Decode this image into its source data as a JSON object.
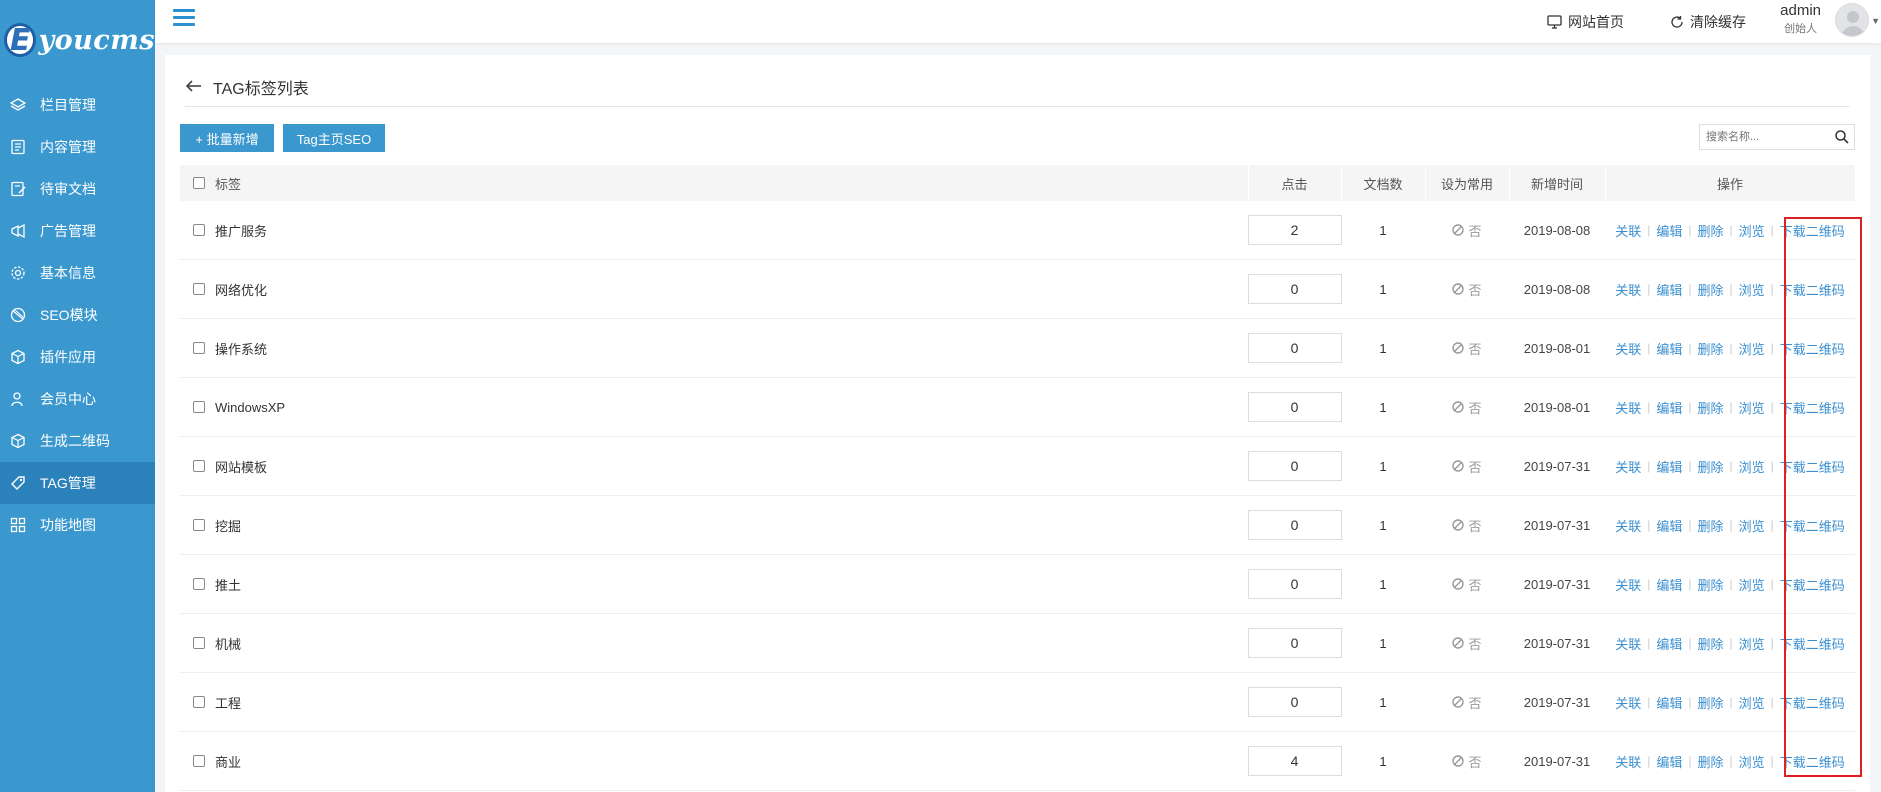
{
  "brand": {
    "logo_letter": "E",
    "logo_text": "youcms"
  },
  "sidebar": {
    "items": [
      {
        "label": "栏目管理",
        "icon": "layers-icon"
      },
      {
        "label": "内容管理",
        "icon": "document-icon"
      },
      {
        "label": "待审文档",
        "icon": "edit-document-icon"
      },
      {
        "label": "广告管理",
        "icon": "megaphone-icon"
      },
      {
        "label": "基本信息",
        "icon": "gear-icon"
      },
      {
        "label": "SEO模块",
        "icon": "globe-icon"
      },
      {
        "label": "插件应用",
        "icon": "cube-icon"
      },
      {
        "label": "会员中心",
        "icon": "user-icon"
      },
      {
        "label": "生成二维码",
        "icon": "cube-icon"
      },
      {
        "label": "TAG管理",
        "icon": "tag-icon",
        "active": true
      },
      {
        "label": "功能地图",
        "icon": "grid-icon"
      }
    ]
  },
  "topbar": {
    "home_label": "网站首页",
    "clear_cache_label": "清除缓存",
    "user_name": "admin",
    "user_role": "创始人"
  },
  "page": {
    "title": "TAG标签列表"
  },
  "toolbar": {
    "batch_add_label": "+ 批量新增",
    "tag_seo_label": "Tag主页SEO",
    "search_placeholder": "搜索名称..."
  },
  "table": {
    "headers": {
      "tag": "标签",
      "clicks": "点击",
      "docs": "文档数",
      "common": "设为常用",
      "added": "新增时间",
      "actions": "操作"
    },
    "actions": [
      "关联",
      "编辑",
      "删除",
      "浏览",
      "下载二维码"
    ],
    "not_common_label": "否",
    "rows": [
      {
        "tag": "推广服务",
        "clicks": "2",
        "docs": "1",
        "date": "2019-08-08"
      },
      {
        "tag": "网络优化",
        "clicks": "0",
        "docs": "1",
        "date": "2019-08-08"
      },
      {
        "tag": "操作系统",
        "clicks": "0",
        "docs": "1",
        "date": "2019-08-01"
      },
      {
        "tag": "WindowsXP",
        "clicks": "0",
        "docs": "1",
        "date": "2019-08-01"
      },
      {
        "tag": "网站模板",
        "clicks": "0",
        "docs": "1",
        "date": "2019-07-31"
      },
      {
        "tag": "挖掘",
        "clicks": "0",
        "docs": "1",
        "date": "2019-07-31"
      },
      {
        "tag": "推土",
        "clicks": "0",
        "docs": "1",
        "date": "2019-07-31"
      },
      {
        "tag": "机械",
        "clicks": "0",
        "docs": "1",
        "date": "2019-07-31"
      },
      {
        "tag": "工程",
        "clicks": "0",
        "docs": "1",
        "date": "2019-07-31"
      },
      {
        "tag": "商业",
        "clicks": "4",
        "docs": "1",
        "date": "2019-07-31"
      }
    ]
  },
  "colors": {
    "sidebar": "#3a98cf",
    "sidebar_active": "#2b82bb",
    "link": "#3b8fd0",
    "highlight": "#e02020"
  }
}
